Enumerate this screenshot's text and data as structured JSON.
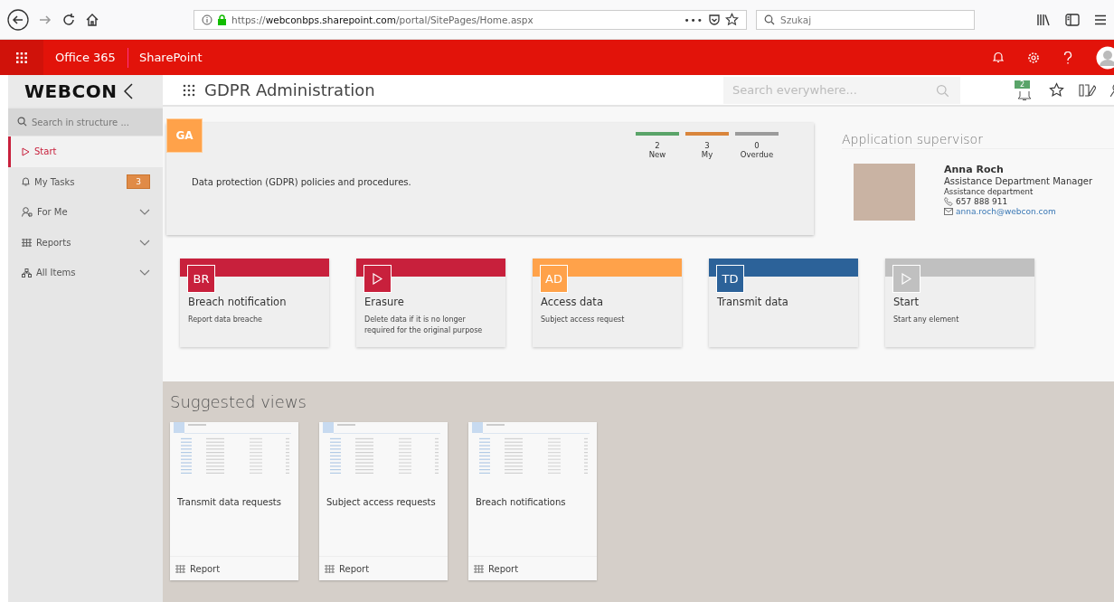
{
  "browser": {
    "url": "https://**webconbps.sharepoint.com**/portal/SitePages/Home.aspx",
    "more": "•••",
    "search": {
      "placeholder": "Szukaj"
    }
  },
  "suite_bar": {
    "app": "Office 365",
    "site": "SharePoint"
  },
  "header": {
    "logo": "WEBCON",
    "title": "GDPR Administration",
    "search": {
      "placeholder": "Search everywhere..."
    },
    "notification_count": "2"
  },
  "sidebar": {
    "search": {
      "placeholder": "Search in structure ..."
    },
    "items": [
      {
        "label": "Start",
        "kind": "link",
        "selected": true
      },
      {
        "label": "My Tasks",
        "kind": "link",
        "selected": false,
        "badge": "3"
      },
      {
        "label": "For Me",
        "kind": "group",
        "selected": false,
        "expanded": false
      },
      {
        "label": "Reports",
        "kind": "group",
        "selected": false,
        "expanded": false
      },
      {
        "label": "All Items",
        "kind": "group",
        "selected": false,
        "expanded": false
      }
    ]
  },
  "app_card": {
    "badge": "GA",
    "description": "Data protection (GDPR) policies and procedures.",
    "counters": [
      {
        "value": "2",
        "label": "New",
        "color": "#5aa469"
      },
      {
        "value": "3",
        "label": "My",
        "color": "#d9853b"
      },
      {
        "value": "0",
        "label": "Overdue",
        "color": "#9b9b9b"
      }
    ]
  },
  "supervisor": {
    "heading": "Application supervisor",
    "name": "Anna Roch",
    "position": "Assistance Department Manager",
    "department": "Assistance department",
    "phone": "657 888 911",
    "email": "anna.roch@webcon.com"
  },
  "tiles": [
    {
      "kind": "initials",
      "icon_text": "BR",
      "title": "Breach notification",
      "description": "Report data breache",
      "color": "#c8203c"
    },
    {
      "kind": "play",
      "title": "Erasure",
      "description": "Delete data if it is no longer required for the original purpose",
      "color": "#c8203c"
    },
    {
      "kind": "initials",
      "icon_text": "AD",
      "title": "Access data",
      "description": "Subject access request",
      "color": "#ffa24a"
    },
    {
      "kind": "initials",
      "icon_text": "TD",
      "title": "Transmit data",
      "color": "#2c6299"
    },
    {
      "kind": "play",
      "title": "Start",
      "description": "Start any element",
      "color": "#c0c0c0"
    }
  ],
  "suggested_views": {
    "heading": "Suggested views",
    "items": [
      {
        "title": "Transmit data requests",
        "type": "Report"
      },
      {
        "title": "Subject access requests",
        "type": "Report"
      },
      {
        "title": "Breach notifications",
        "type": "Report"
      }
    ]
  }
}
